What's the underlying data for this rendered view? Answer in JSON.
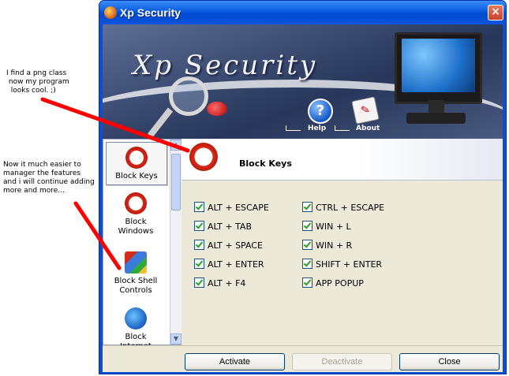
{
  "notes": {
    "note1": "I find a png class\n now my program\n  looks cool. ;)",
    "note2": "Now it much easier to\nmanager the features\nand i will continue adding\nmore and more..."
  },
  "window": {
    "title": "Xp Security",
    "close_glyph": "×"
  },
  "banner": {
    "title": "Xp Security",
    "help_label": "Help",
    "about_label": "About",
    "help_icon": "?",
    "about_icon": "✎"
  },
  "sidebar": {
    "items": [
      {
        "label": "Block Keys",
        "icon": "block-keys-icon"
      },
      {
        "label": "Block Windows",
        "icon": "block-windows-icon"
      },
      {
        "label": "Block Shell Controls",
        "icon": "block-shell-icon"
      },
      {
        "label": "Block Internet",
        "icon": "block-internet-icon"
      }
    ],
    "up_arrow": "▲",
    "down_arrow": "▼"
  },
  "main": {
    "title": "Block Keys",
    "options_left": [
      "ALT + ESCAPE",
      "ALT + TAB",
      "ALT + SPACE",
      "ALT + ENTER",
      "ALT + F4"
    ],
    "options_right": [
      "CTRL + ESCAPE",
      "WIN + L",
      "WIN + R",
      "SHIFT + ENTER",
      "APP POPUP"
    ]
  },
  "footer": {
    "activate_label": "Activate",
    "deactivate_label": "Deactivate",
    "close_label": "Close"
  },
  "colors": {
    "titlebar": "#0a5be0",
    "annotation_arrow": "#ff0000",
    "check": "#21a121"
  }
}
